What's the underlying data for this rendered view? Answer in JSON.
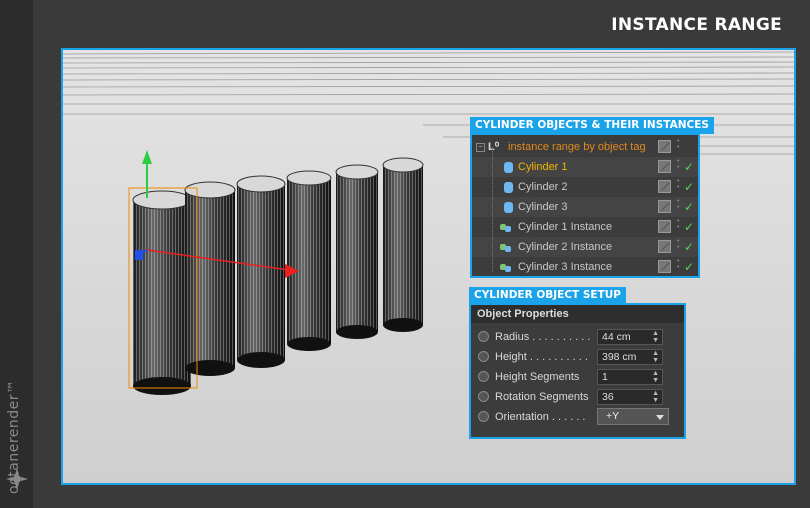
{
  "page": {
    "title": "INSTANCE RANGE"
  },
  "brand": {
    "name": "octanerender™"
  },
  "objects_panel": {
    "heading": "CYLINDER OBJECTS & THEIR INSTANCES",
    "root_label": "instance range by object tag",
    "items": [
      {
        "label": "Cylinder 1",
        "type": "cylinder",
        "selected": true
      },
      {
        "label": "Cylinder 2",
        "type": "cylinder",
        "selected": false
      },
      {
        "label": "Cylinder 3",
        "type": "cylinder",
        "selected": false
      },
      {
        "label": "Cylinder 1 Instance",
        "type": "instance",
        "selected": false
      },
      {
        "label": "Cylinder 2 Instance",
        "type": "instance",
        "selected": false
      },
      {
        "label": "Cylinder 3 Instance",
        "type": "instance",
        "selected": false
      }
    ]
  },
  "setup_panel": {
    "heading": "CYLINDER OBJECT SETUP",
    "section": "Object Properties",
    "properties": [
      {
        "label": "Radius . . . . . . . . . .",
        "value": "44 cm"
      },
      {
        "label": "Height . . . . . . . . . .",
        "value": "398 cm"
      },
      {
        "label": "Height Segments",
        "value": "1"
      },
      {
        "label": "Rotation Segments",
        "value": "36"
      },
      {
        "label": "Orientation . . . . . .",
        "value": "+Y"
      }
    ]
  },
  "colors": {
    "accent": "#1aa3e8",
    "selected_text": "#f0b400",
    "root_text": "#e08a1e",
    "check": "#4cd964"
  }
}
